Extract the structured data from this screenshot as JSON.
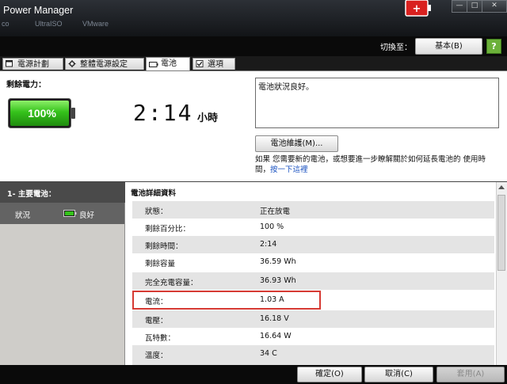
{
  "window": {
    "title": "Power Manager",
    "desktop_ghost_labels": [
      "co",
      "UltraISO",
      "VMware"
    ],
    "controls": [
      "—",
      "□",
      "✕"
    ]
  },
  "toolbar": {
    "switch_label": "切換至：",
    "mode_button_label": "基本(B)",
    "help_label": "?"
  },
  "tabs": [
    {
      "label": "電源計劃",
      "icon": "power-plan-icon"
    },
    {
      "label": "整體電源設定",
      "icon": "gear-icon"
    },
    {
      "label": "電池",
      "icon": "battery-icon",
      "active": true
    },
    {
      "label": "選項",
      "icon": "checkbox-icon"
    }
  ],
  "battery": {
    "remaining_label": "剩餘電力：",
    "percent_text": "100%",
    "percent_value": 100,
    "time_text": "2:14",
    "time_unit": "小時",
    "status_text": "電池狀況良好。",
    "maintain_button": "電池維護(M)...",
    "info_text": "如果 您需要新的電池，或想要進一步瞭解關於如何延長電池的 使用時間，",
    "info_link": "按一下這裡"
  },
  "left_panel": {
    "primary_label": "1- 主要電池：",
    "state_label": "狀況",
    "state_value": "良好"
  },
  "details": {
    "title": "電池詳細資料",
    "rows": [
      {
        "label": "狀態：",
        "value": "正在放電"
      },
      {
        "label": "剩餘百分比：",
        "value": "100 %"
      },
      {
        "label": "剩餘時間：",
        "value": "2:14"
      },
      {
        "label": "剩餘容量",
        "value": "36.59 Wh"
      },
      {
        "label": "完全充電容量：",
        "value": "36.93 Wh"
      },
      {
        "label": "電流：",
        "value": "1.03 A"
      },
      {
        "label": "電壓：",
        "value": "16.18 V"
      },
      {
        "label": "瓦特數：",
        "value": "16.64 W"
      },
      {
        "label": "溫度：",
        "value": "34 C"
      }
    ]
  },
  "footer": {
    "ok_label": "確定(O)",
    "cancel_label": "取消(C)",
    "apply_label": "套用(A)"
  },
  "colors": {
    "battery_green": "#35c21b",
    "link_blue": "#1b53c1",
    "highlight_red": "#d63a33",
    "help_green": "#6cb13a"
  }
}
